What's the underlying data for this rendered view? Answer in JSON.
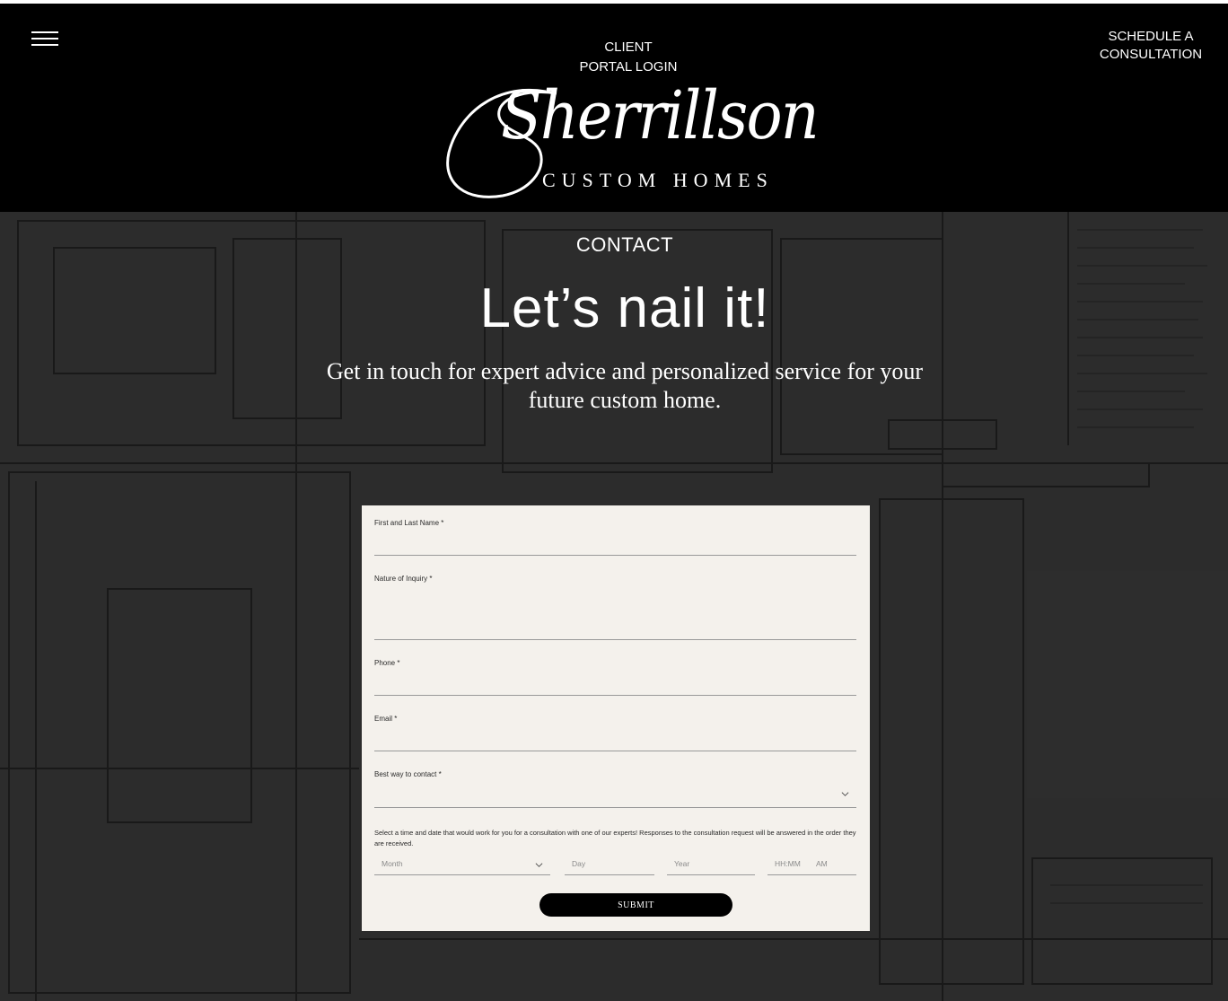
{
  "header": {
    "portal_login": "CLIENT\nPORTAL LOGIN",
    "schedule": "SCHEDULE A\nCONSULTATION",
    "logo_word": "Sherrillson",
    "logo_sub": "CUSTOM HOMES",
    "menu_icon": "hamburger-menu-icon"
  },
  "hero": {
    "label": "CONTACT",
    "title": "Let’s nail it!",
    "subtitle": "Get in touch for expert advice and personalized service for your future custom home."
  },
  "form": {
    "name_label": "First and Last Name *",
    "inquiry_label": "Nature of Inquiry *",
    "phone_label": "Phone *",
    "email_label": "Email *",
    "best_contact_label": "Best way to contact *",
    "consult_note": "Select a time and date that would work for you for a consultation with one of our experts! Responses to the consultation request will be answered in the order they are received.",
    "month_placeholder": "Month",
    "day_placeholder": "Day",
    "year_placeholder": "Year",
    "time_placeholder": "HH:MM",
    "ampm": "AM",
    "submit_label": "SUBMIT"
  },
  "colors": {
    "header_bg": "#000000",
    "form_bg": "#f4f1ec",
    "button_bg": "#000000"
  }
}
